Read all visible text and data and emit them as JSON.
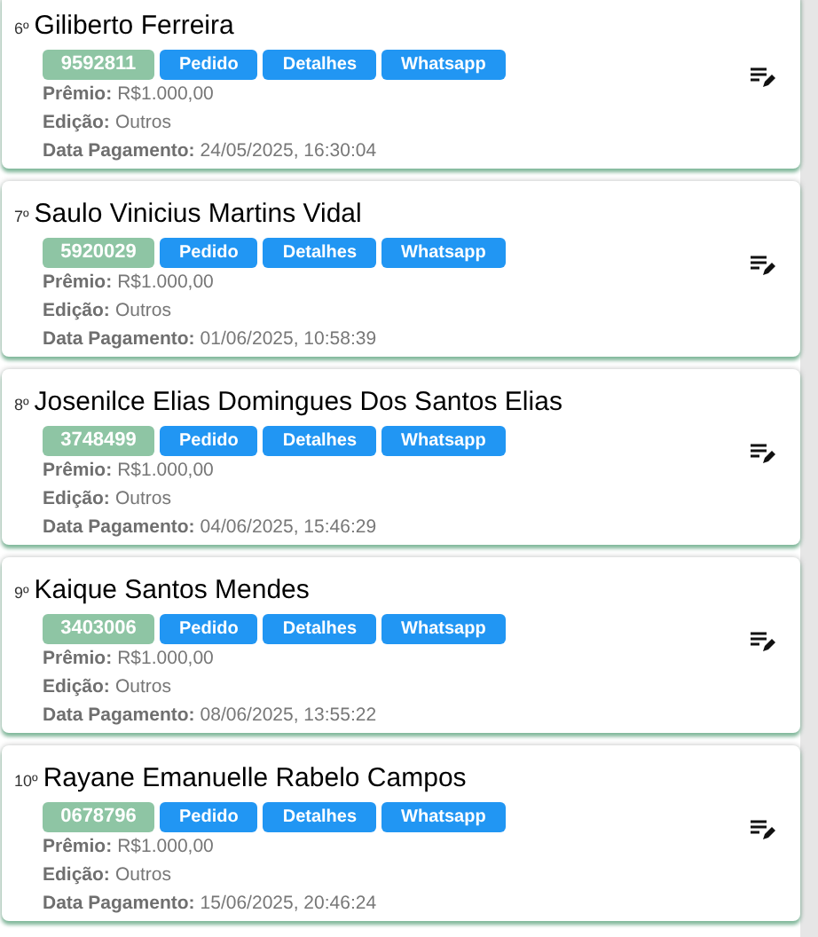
{
  "winners": [
    {
      "rank": "6º",
      "name": "Giliberto Ferreira",
      "code": "9592811",
      "buttons": [
        "Pedido",
        "Detalhes",
        "Whatsapp"
      ],
      "fields": [
        {
          "label": "Prêmio:",
          "value": "R$1.000,00"
        },
        {
          "label": "Edição:",
          "value": "Outros"
        },
        {
          "label": "Data Pagamento:",
          "value": "24/05/2025, 16:30:04"
        }
      ]
    },
    {
      "rank": "7º",
      "name": "Saulo Vinicius Martins Vidal",
      "code": "5920029",
      "buttons": [
        "Pedido",
        "Detalhes",
        "Whatsapp"
      ],
      "fields": [
        {
          "label": "Prêmio:",
          "value": "R$1.000,00"
        },
        {
          "label": "Edição:",
          "value": "Outros"
        },
        {
          "label": "Data Pagamento:",
          "value": "01/06/2025, 10:58:39"
        }
      ]
    },
    {
      "rank": "8º",
      "name": "Josenilce Elias Domingues Dos Santos Elias",
      "code": "3748499",
      "buttons": [
        "Pedido",
        "Detalhes",
        "Whatsapp"
      ],
      "fields": [
        {
          "label": "Prêmio:",
          "value": "R$1.000,00"
        },
        {
          "label": "Edição:",
          "value": "Outros"
        },
        {
          "label": "Data Pagamento:",
          "value": "04/06/2025, 15:46:29"
        }
      ]
    },
    {
      "rank": "9º",
      "name": "Kaique Santos Mendes",
      "code": "3403006",
      "buttons": [
        "Pedido",
        "Detalhes",
        "Whatsapp"
      ],
      "fields": [
        {
          "label": "Prêmio:",
          "value": "R$1.000,00"
        },
        {
          "label": "Edição:",
          "value": "Outros"
        },
        {
          "label": "Data Pagamento:",
          "value": "08/06/2025, 13:55:22"
        }
      ]
    },
    {
      "rank": "10º",
      "name": "Rayane Emanuelle Rabelo Campos",
      "code": "0678796",
      "buttons": [
        "Pedido",
        "Detalhes",
        "Whatsapp"
      ],
      "fields": [
        {
          "label": "Prêmio:",
          "value": "R$1.000,00"
        },
        {
          "label": "Edição:",
          "value": "Outros"
        },
        {
          "label": "Data Pagamento:",
          "value": "15/06/2025, 20:46:24"
        }
      ]
    }
  ]
}
